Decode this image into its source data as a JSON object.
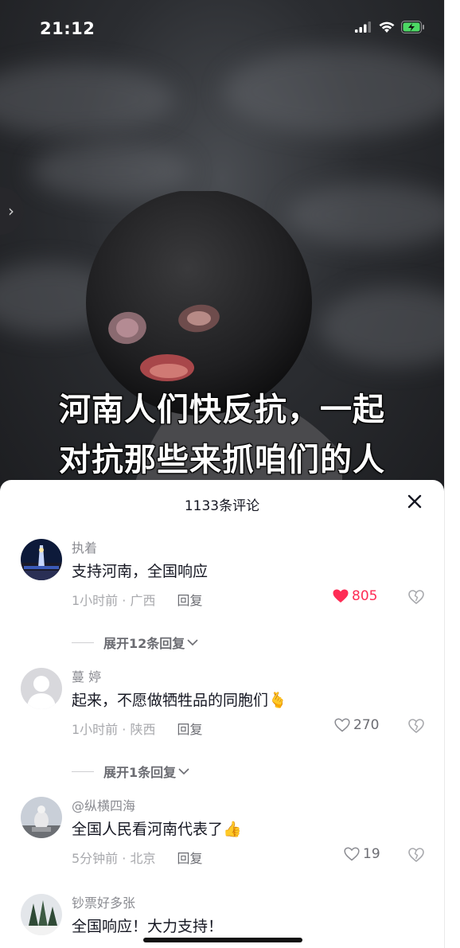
{
  "status_bar": {
    "time": "21:12"
  },
  "video": {
    "subtitle_line1": "河南人们快反抗，一起",
    "subtitle_line2": "对抗那些来抓咱们的人"
  },
  "comments_sheet": {
    "title": "1133条评论",
    "close_icon": "close-icon",
    "comments": [
      {
        "user": "执着",
        "text": "支持河南，全国响应",
        "time_location": "1小时前 · 广西",
        "reply_label": "回复",
        "likes": "805",
        "liked": true,
        "expand_label": "展开12条回复"
      },
      {
        "user": "蔓 婷",
        "text": "起来，不愿做牺牲品的同胞们",
        "emoji": "🫰",
        "time_location": "1小时前 · 陕西",
        "reply_label": "回复",
        "likes": "270",
        "liked": false,
        "expand_label": "展开1条回复"
      },
      {
        "user": "@纵横四海",
        "text": "全国人民看河南代表了",
        "emoji": "👍",
        "time_location": "5分钟前 · 北京",
        "reply_label": "回复",
        "likes": "19",
        "liked": false
      },
      {
        "user": "钞票好多张",
        "text": "全国响应！大力支持！"
      }
    ]
  },
  "colors": {
    "like_red": "#fe2c55",
    "text_primary": "#161823",
    "text_secondary": "#8a8b91"
  }
}
